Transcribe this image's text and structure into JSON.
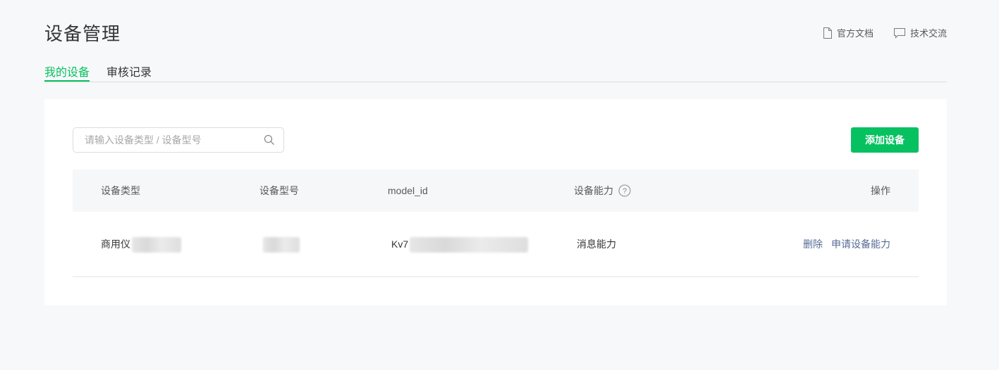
{
  "page": {
    "title": "设备管理",
    "header_links": [
      {
        "label": "官方文档",
        "icon": "document-icon"
      },
      {
        "label": "技术交流",
        "icon": "chat-bubble-icon"
      }
    ]
  },
  "tabs": [
    {
      "label": "我的设备",
      "active": true
    },
    {
      "label": "审核记录",
      "active": false
    }
  ],
  "toolbar": {
    "search_placeholder": "请输入设备类型 / 设备型号",
    "search_value": "",
    "add_label": "添加设备"
  },
  "table": {
    "headers": {
      "type": "设备类型",
      "model": "设备型号",
      "model_id": "model_id",
      "ability": "设备能力",
      "ops": "操作"
    },
    "rows": [
      {
        "type": "商用仪",
        "model": "",
        "model_id": "Kv7",
        "ability": "消息能力",
        "actions": [
          "删除",
          "申请设备能力"
        ]
      }
    ]
  },
  "colors": {
    "accent": "#07c160",
    "link": "#576b95",
    "background": "#f7f8fa"
  }
}
